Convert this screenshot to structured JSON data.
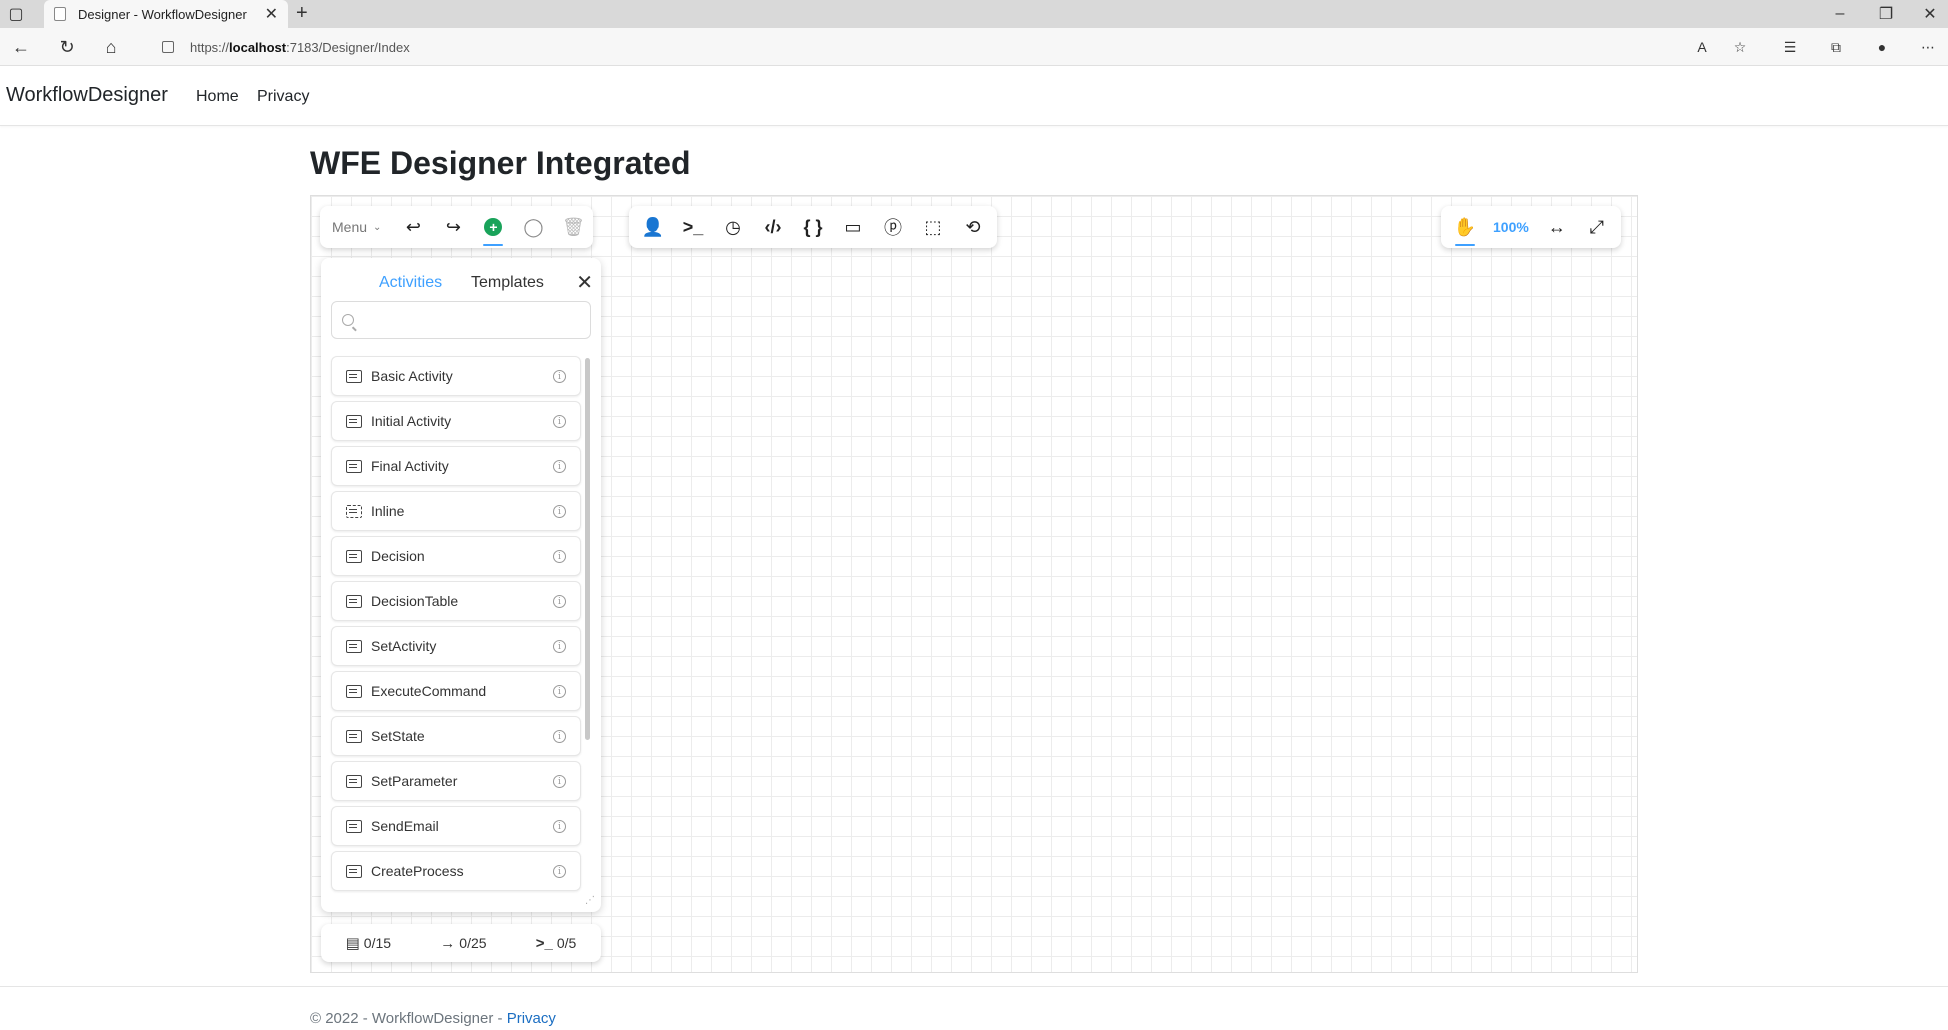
{
  "browser": {
    "tab_title": "Designer - WorkflowDesigner",
    "tab_close": "✕",
    "new_tab": "+",
    "url_prefix": "https://",
    "url_host": "localhost",
    "url_rest": ":7183/Designer/Index"
  },
  "site": {
    "brand": "WorkflowDesigner",
    "nav": [
      "Home",
      "Privacy"
    ]
  },
  "page": {
    "title": "WFE Designer Integrated"
  },
  "designer": {
    "menu_label": "Menu",
    "zoom": "100%",
    "panel": {
      "tabs": [
        "Activities",
        "Templates"
      ],
      "search_placeholder": "",
      "items": [
        {
          "label": "Basic Activity",
          "icon": "basic-activity-icon"
        },
        {
          "label": "Initial Activity",
          "icon": "initial-activity-icon"
        },
        {
          "label": "Final Activity",
          "icon": "final-activity-icon"
        },
        {
          "label": "Inline",
          "icon": "inline-icon"
        },
        {
          "label": "Decision",
          "icon": "decision-icon"
        },
        {
          "label": "DecisionTable",
          "icon": "decision-table-icon"
        },
        {
          "label": "SetActivity",
          "icon": "set-activity-icon"
        },
        {
          "label": "ExecuteCommand",
          "icon": "execute-command-icon"
        },
        {
          "label": "SetState",
          "icon": "set-state-icon"
        },
        {
          "label": "SetParameter",
          "icon": "set-parameter-icon"
        },
        {
          "label": "SendEmail",
          "icon": "send-email-icon"
        },
        {
          "label": "CreateProcess",
          "icon": "create-process-icon"
        }
      ]
    },
    "counters": {
      "activities": "0/15",
      "transitions": "0/25",
      "commands": "0/5"
    }
  },
  "footer": {
    "text": "© 2022 - WorkflowDesigner - ",
    "link": "Privacy"
  },
  "colors": {
    "accent": "#3ea0ff",
    "add_green": "#19a35a",
    "link": "#1b6ec2"
  }
}
